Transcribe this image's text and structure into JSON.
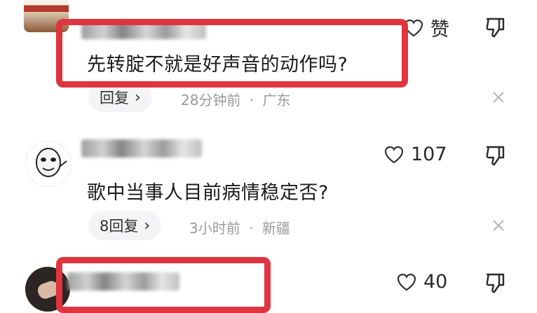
{
  "comments": [
    {
      "text": "先转腚不就是好声音的动作吗?",
      "like_label": "赞",
      "reply_label": "回复",
      "time": "28分钟前",
      "location": "广东",
      "separator": "·"
    },
    {
      "text": "歌中当事人目前病情稳定否?",
      "like_count": "107",
      "reply_label": "8回复",
      "time": "3小时前",
      "location": "新疆",
      "separator": "·"
    },
    {
      "like_count": "40"
    }
  ],
  "colors": {
    "highlight": "#e0343f",
    "meta": "#9a9a9a",
    "pill_bg": "#f4f4f6"
  },
  "icons": [
    "heart-outline-icon",
    "thumbs-down-icon",
    "close-icon",
    "chevron-right-icon"
  ]
}
